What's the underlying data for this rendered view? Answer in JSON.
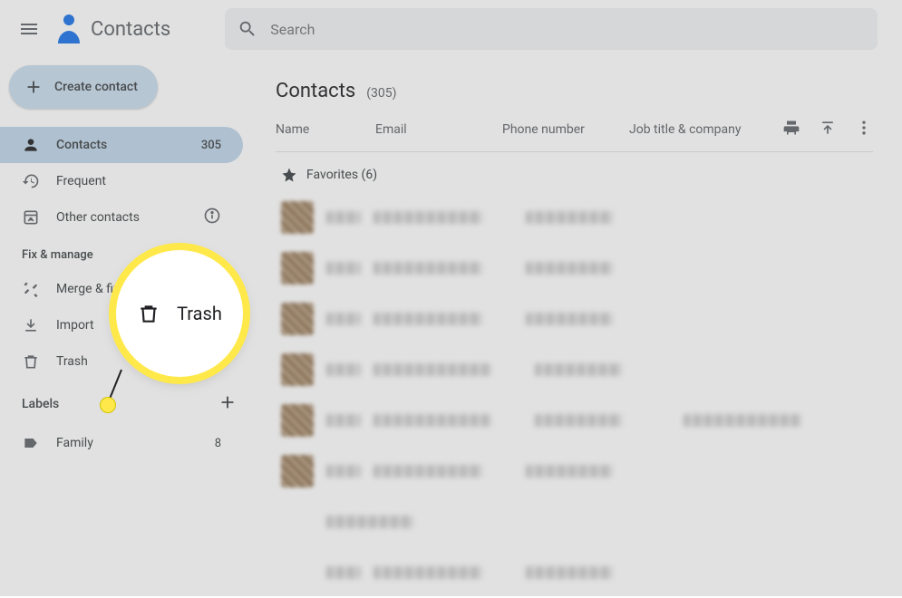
{
  "header": {
    "app_title": "Contacts",
    "search_placeholder": "Search"
  },
  "sidebar": {
    "create_label": "Create contact",
    "nav": {
      "contacts": {
        "label": "Contacts",
        "count": "305"
      },
      "frequent": {
        "label": "Frequent"
      },
      "other": {
        "label": "Other contacts"
      }
    },
    "fix_manage_header": "Fix & manage",
    "fix_manage": {
      "merge": {
        "label": "Merge & fix"
      },
      "import": {
        "label": "Import"
      },
      "trash": {
        "label": "Trash"
      }
    },
    "labels_header": "Labels",
    "labels": {
      "family": {
        "label": "Family",
        "count": "8"
      }
    }
  },
  "main": {
    "title": "Contacts",
    "count": "(305)",
    "columns": {
      "name": "Name",
      "email": "Email",
      "phone": "Phone number",
      "job": "Job title & company"
    },
    "favorites_label": "Favorites (6)"
  },
  "callout": {
    "label": "Trash"
  }
}
